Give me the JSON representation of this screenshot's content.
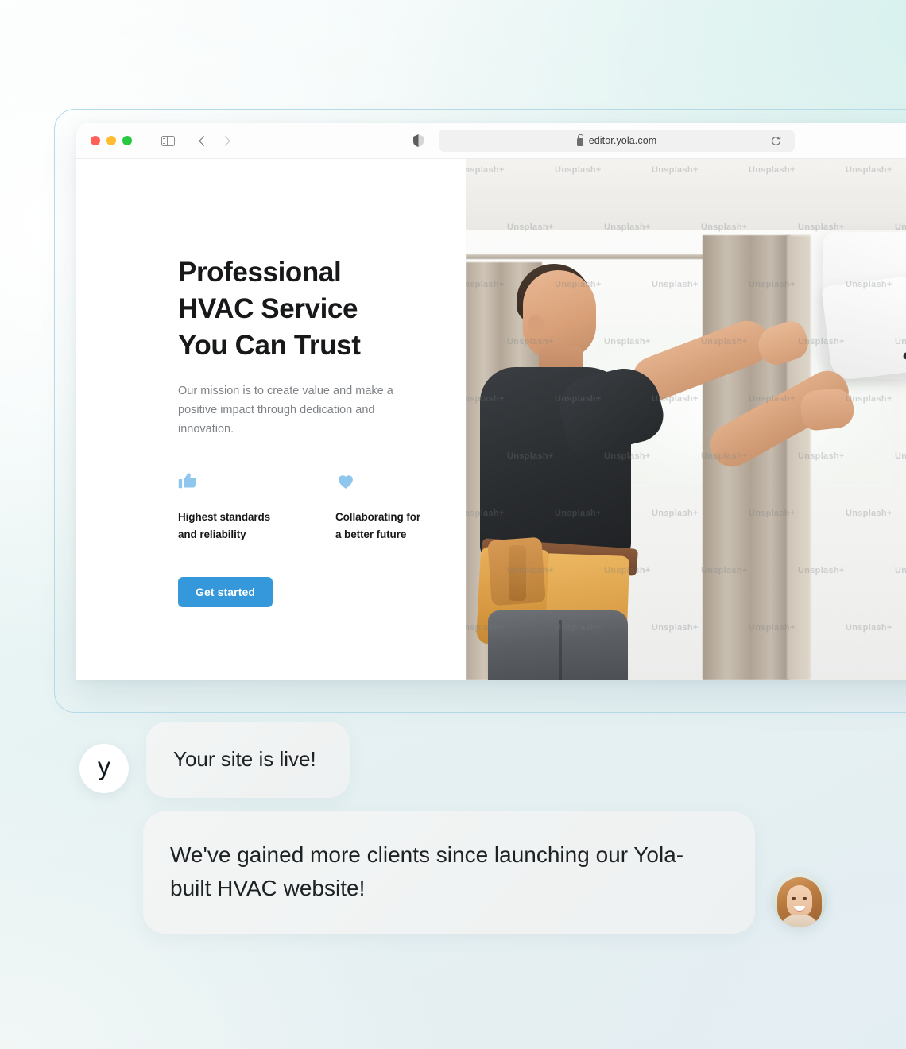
{
  "browser": {
    "url": "editor.yola.com",
    "lock_icon": "lock-icon",
    "reload_icon": "reload-icon",
    "sidebar_icon": "sidebar-toggle-icon",
    "back_icon": "chevron-left-icon",
    "forward_icon": "chevron-right-icon",
    "privacy_icon": "shield-icon",
    "traffic_lights": [
      "close-red",
      "minimize-yellow",
      "maximize-green"
    ]
  },
  "site": {
    "hero": {
      "title_lines": [
        "Professional",
        "HVAC Service",
        "You Can Trust"
      ],
      "title": "Professional HVAC Service You Can Trust",
      "subtitle": "Our mission is to create value and make a positive impact through dedication and innovation.",
      "cta_label": "Get started",
      "cta_color": "#3498db"
    },
    "features": [
      {
        "icon": "thumbs-up-icon",
        "label_line1": "Highest standards",
        "label_line2": "and reliability",
        "icon_color": "#8ec6ed"
      },
      {
        "icon": "heart-icon",
        "label_line1": "Collaborating for",
        "label_line2": "a better future",
        "icon_color": "#8ec6ed"
      }
    ],
    "hero_image": {
      "alt": "HVAC technician in black t-shirt with leather tool belt servicing a white wall-mounted air conditioner",
      "watermark_text": "Unsplash+"
    }
  },
  "chat": {
    "messages": [
      {
        "sender": "yola",
        "avatar_mark": "y",
        "avatar_name": "yola-logo-avatar",
        "text": "Your site is live!"
      },
      {
        "sender": "customer",
        "avatar_name": "customer-photo-avatar",
        "text": "We've gained more clients since launching our Yola-built HVAC website!"
      }
    ]
  },
  "theme": {
    "accent": "#3498db",
    "icon_blue": "#8ec6ed",
    "bubble_bg": "#f1f4f4",
    "frame_outline": "#b6dce8"
  }
}
